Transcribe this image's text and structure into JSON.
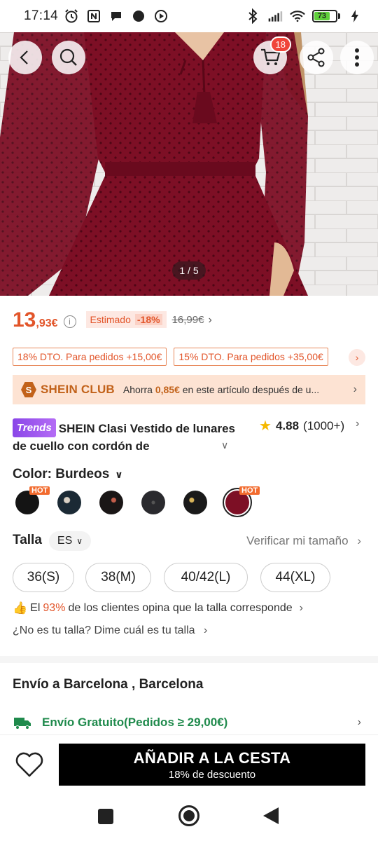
{
  "status_bar": {
    "time": "17:14",
    "battery": "73",
    "icons": [
      "alarm-icon",
      "nfc-icon",
      "chat-icon",
      "circle-icon",
      "play-icon",
      "bluetooth-icon",
      "signal-icon",
      "wifi-icon",
      "battery-icon",
      "charging-icon"
    ]
  },
  "header": {
    "cart_count": "18",
    "image_pager": "1 / 5"
  },
  "price": {
    "main": "13",
    "decimal": ",93€",
    "estimated_label": "Estimado",
    "discount": "-18%",
    "original": "16,99€"
  },
  "coupons": [
    {
      "label": "18% DTO. Para pedidos +15,00€"
    },
    {
      "label": "15% DTO. Para pedidos +35,00€"
    }
  ],
  "club": {
    "name": "SHEIN CLUB",
    "text_prefix": "Ahorra ",
    "savings": "0,85€",
    "text_suffix": " en este artículo después de u..."
  },
  "product": {
    "badge": "Trends",
    "title": "SHEIN Clasi Vestido de lunares de cuello con cordón de",
    "rating": "4.88",
    "reviews": "(1000+)"
  },
  "color": {
    "label": "Color: ",
    "value": "Burdeos",
    "hot_label": "HOT",
    "swatches": [
      {
        "name": "black",
        "hex": "#141414"
      },
      {
        "name": "floral-navy",
        "hex": "#1b2a35"
      },
      {
        "name": "floral-black",
        "hex": "#1a1616"
      },
      {
        "name": "glitter-black",
        "hex": "#2a2a2e"
      },
      {
        "name": "black-gold",
        "hex": "#1a1a1a"
      },
      {
        "name": "burgundy",
        "hex": "#7d0f25"
      }
    ]
  },
  "size": {
    "label": "Talla",
    "region": "ES",
    "verify": "Verificar mi tamaño",
    "options": [
      "36(S)",
      "38(M)",
      "40/42(L)",
      "44(XL)"
    ],
    "fit_prefix": "El ",
    "fit_pct": "93%",
    "fit_suffix": " de los clientes opina que la talla corresponde",
    "ask": "¿No es tu talla? Dime cuál es tu talla"
  },
  "shipping": {
    "title": "Envío a Barcelona , Barcelona",
    "free": "Envío Gratuito(Pedidos ≥ 29,00€)"
  },
  "cta": {
    "main": "AÑADIR A LA CESTA",
    "sub": "18% de descuento"
  },
  "colors": {
    "accent": "#e2552a",
    "club": "#c2621a",
    "green": "#1f8a4c",
    "dress": "#7d0f25"
  }
}
